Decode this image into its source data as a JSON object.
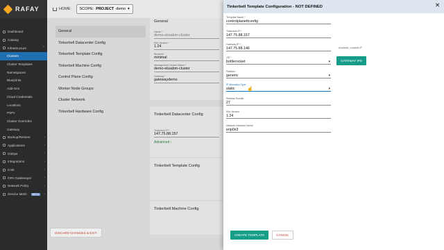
{
  "brand": {
    "name": "RAFAY"
  },
  "topbar": {
    "home_label": "HOME",
    "scope_label": "SCOPE:",
    "scope_type": "PROJECT",
    "scope_value": "demo"
  },
  "sidebar": {
    "items": [
      {
        "label": "Dashboard"
      },
      {
        "label": "Catalog"
      },
      {
        "label": "Infrastructure"
      },
      {
        "label": "Clusters"
      },
      {
        "label": "Cluster Templates"
      },
      {
        "label": "Namespaces"
      },
      {
        "label": "Blueprints"
      },
      {
        "label": "Add-Ons"
      },
      {
        "label": "Cloud Credentials"
      },
      {
        "label": "Locations"
      },
      {
        "label": "PSPs"
      },
      {
        "label": "Cluster Overrides"
      },
      {
        "label": "Gateway"
      },
      {
        "label": "Backup/Restore"
      },
      {
        "label": "Applications"
      },
      {
        "label": "GitOps"
      },
      {
        "label": "Integrations"
      },
      {
        "label": "Cost"
      },
      {
        "label": "OPA Gatekeeper"
      },
      {
        "label": "Network Policy"
      },
      {
        "label": "Service Mesh",
        "badge": "BETA"
      }
    ]
  },
  "config_nav": {
    "items": [
      "General",
      "Tinkerbell Datacenter Config",
      "Tinkerbell Template Config",
      "Tinkerbell Machine Config",
      "Control Plane Config",
      "Worker Node Groups",
      "Cluster Network",
      "Tinkerbell Hardware Config"
    ]
  },
  "general_card": {
    "section_title": "General",
    "fields": [
      {
        "label": "Name *",
        "value": "demo-eksabm-cluster"
      },
      {
        "label": "K8s Version *",
        "value": "1.24"
      },
      {
        "label": "Blueprint",
        "value": "minimal"
      },
      {
        "label": "Management Cluster Name *",
        "value": "demo-eksabm-cluster"
      },
      {
        "label": "Gateway *",
        "value": "gatewaydemo"
      }
    ]
  },
  "datacenter_card": {
    "section_title": "Tinkerbell Datacenter Config",
    "field_label": "Tinkerbell IP *",
    "field_value": "147.75.88.157",
    "advanced": "Advanced"
  },
  "template_card": {
    "section_title": "Tinkerbell Template Config"
  },
  "machine_card": {
    "section_title": "Tinkerbell Machine Config"
  },
  "discard_label": "DISCARD CHANGES & EXIT",
  "modal": {
    "title": "Tinkerbell Template Configuration - NOT DEFINED",
    "fields": [
      {
        "label": "Template Name *",
        "value": "controlplanettconfig"
      },
      {
        "label": "Tinkerbell IP *",
        "value": "147.75.88.157"
      },
      {
        "label": "Gateway IP *",
        "value": "147.75.88.146"
      },
      {
        "label": "OS *",
        "value": "bottlerocket",
        "dropdown": true
      },
      {
        "label": "Platform",
        "value": "generic",
        "dropdown": true
      },
      {
        "label": "IP Allocation Type",
        "value": "static",
        "dropdown": true
      },
      {
        "label": "Release Bundle",
        "value": "27"
      },
      {
        "label": "K8s Version",
        "value": "1.24"
      },
      {
        "label": "Network Interface Name",
        "value": "enp0s3"
      }
    ],
    "available_ips_label": "Available_routable IP",
    "gateway_ips_button": "GATEWAY IPS",
    "create_button": "CREATE TEMPLATE",
    "cancel_button": "CANCEL",
    "colors": {
      "accent": "#169d8a",
      "header_bg": "#dde6ef",
      "active_nav": "#1f6fb2"
    }
  }
}
